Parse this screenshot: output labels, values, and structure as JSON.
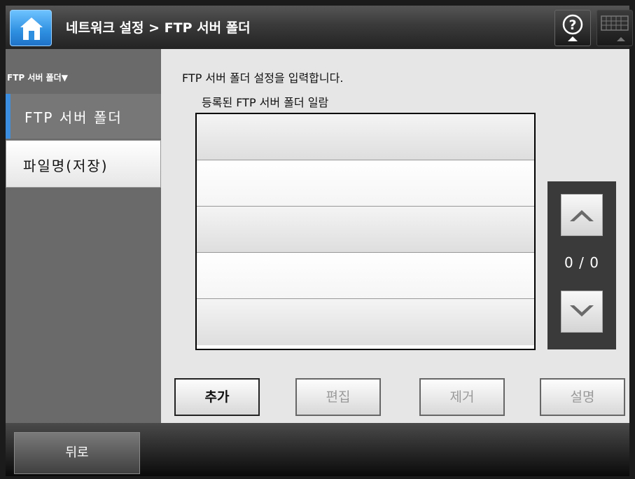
{
  "header": {
    "title": "네트워크 설정 > FTP 서버 폴더",
    "icons": [
      "home-icon",
      "help-icon",
      "keyboard-icon"
    ]
  },
  "sidebar": {
    "dropdown_label": "FTP 서버 폴더▼",
    "items": [
      {
        "label": "FTP 서버 폴더",
        "selected": true
      },
      {
        "label": "파일명(저장)",
        "selected": false
      }
    ]
  },
  "main": {
    "description": "FTP 서버 폴더 설정을 입력합니다.",
    "list_label": "등록된 FTP 서버 폴더 일람",
    "rows": [
      "",
      "",
      "",
      "",
      ""
    ],
    "pager": {
      "text": "0 / 0"
    }
  },
  "buttons": {
    "add": "추가",
    "edit": "편집",
    "remove": "제거",
    "info": "설명"
  },
  "footer": {
    "back": "뒤로"
  },
  "colors": {
    "accent": "#3b8ee0",
    "home_blue": "#2e8fe0"
  }
}
